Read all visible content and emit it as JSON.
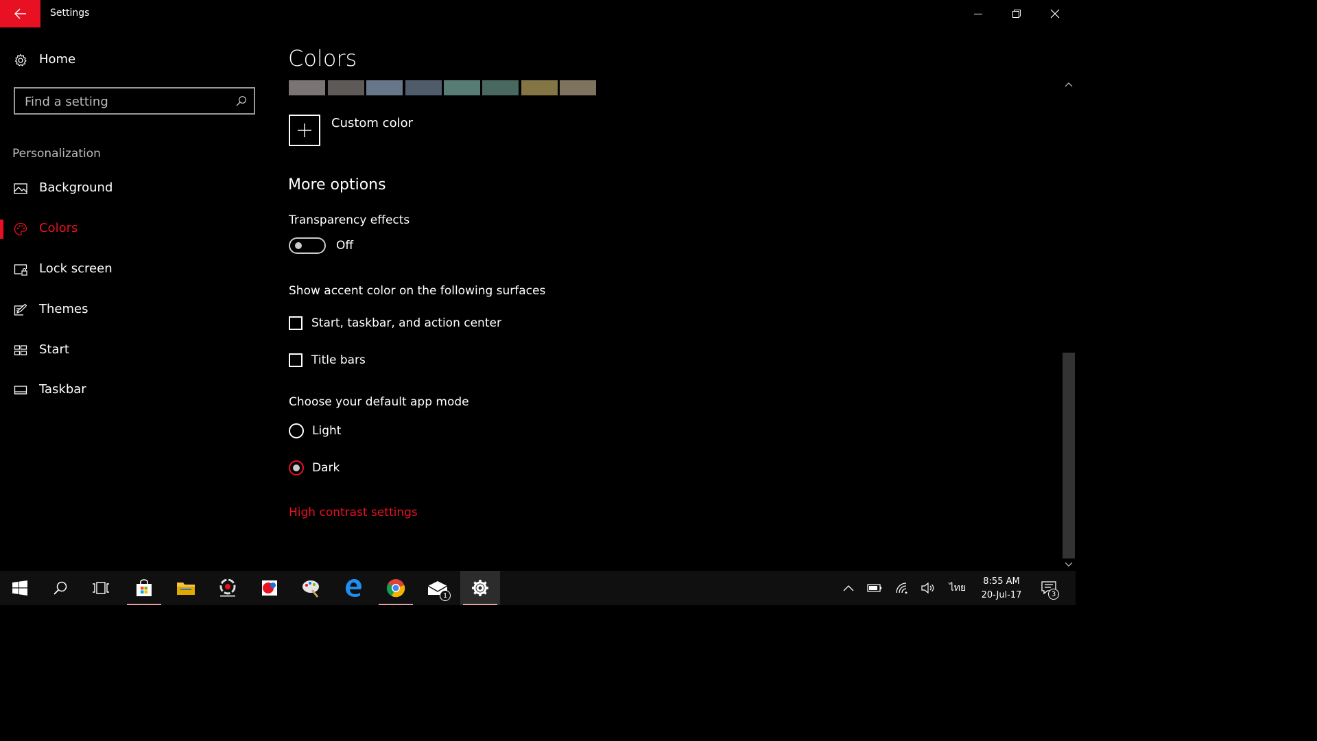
{
  "window": {
    "title": "Settings"
  },
  "sidebar": {
    "home_label": "Home",
    "search_placeholder": "Find a setting",
    "section_label": "Personalization",
    "items": [
      {
        "label": "Background",
        "icon": "picture-icon"
      },
      {
        "label": "Colors",
        "icon": "palette-icon",
        "selected": true
      },
      {
        "label": "Lock screen",
        "icon": "lock-screen-icon"
      },
      {
        "label": "Themes",
        "icon": "themes-icon"
      },
      {
        "label": "Start",
        "icon": "start-icon"
      },
      {
        "label": "Taskbar",
        "icon": "taskbar-icon"
      }
    ]
  },
  "main": {
    "title": "Colors",
    "swatches": [
      "#7a7574",
      "#5d5a58",
      "#68768a",
      "#515c6b",
      "#567c73",
      "#486860",
      "#847545",
      "#7e735f"
    ],
    "custom_color_label": "Custom color",
    "more_options_label": "More options",
    "transparency": {
      "label": "Transparency effects",
      "state": "Off",
      "on": false
    },
    "surfaces_label": "Show accent color on the following surfaces",
    "surfaces": [
      {
        "label": "Start, taskbar, and action center",
        "checked": false
      },
      {
        "label": "Title bars",
        "checked": false
      }
    ],
    "app_mode_label": "Choose your default app mode",
    "app_modes": [
      {
        "label": "Light",
        "selected": false
      },
      {
        "label": "Dark",
        "selected": true
      }
    ],
    "high_contrast_link": "High contrast settings"
  },
  "colors": {
    "accent": "#e81123",
    "background": "#000000",
    "taskbar": "#101010"
  },
  "taskbar": {
    "mail_badge": "1",
    "tray_language": "ไทย",
    "clock_time": "8:55 AM",
    "clock_date": "20-Jul-17",
    "notification_count": "3"
  }
}
